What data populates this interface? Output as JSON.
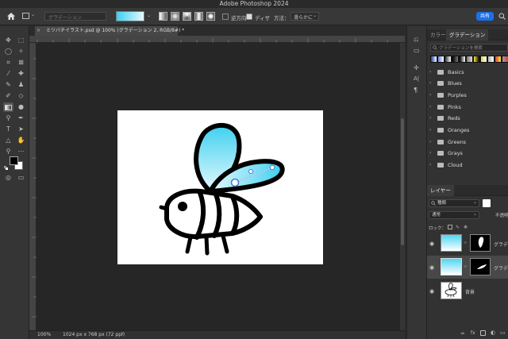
{
  "app": {
    "title": "Adobe Photoshop 2024"
  },
  "options_bar": {
    "preset_placeholder": "グラデーション",
    "reverse_label": "逆方向",
    "dither_label": "ディザ",
    "method_label": "方法：",
    "method_value": "滑らかに",
    "share_label": "共有"
  },
  "document": {
    "tab_title": "ミツバチイラスト.psd @ 100% (グラデーション 2, RGB/8#) *"
  },
  "status_bar": {
    "zoom": "100%",
    "doc_size": "1024 px x 768 px (72 ppi)"
  },
  "gradient_panel": {
    "tabs": [
      "カラー",
      "グラデーション"
    ],
    "search_placeholder": "グラデーションを検索",
    "folders": [
      "Basics",
      "Blues",
      "Purples",
      "Pinks",
      "Reds",
      "Oranges",
      "Greens",
      "Grays",
      "Cloud"
    ],
    "swatch_colors": [
      "#1f3fa8",
      "#ffffff",
      "#6b7fd8",
      "#3a3a3a",
      "#000000",
      "#777777",
      "#ffe640",
      "#d8d84a",
      "#b0b0b0",
      "#e23b3b",
      "#a0a0a0"
    ]
  },
  "layers_panel": {
    "tab": "レイヤー",
    "filter_label": "種類",
    "blend_mode": "通常",
    "opacity_label": "不透明",
    "lock_label": "ロック：",
    "layers": [
      {
        "name": "グラデー"
      },
      {
        "name": "グラデー"
      },
      {
        "name": "背景"
      }
    ]
  },
  "colors": {
    "bee_wing_top": "#3ed0f0",
    "bee_wing_bottom": "#e6f9fd",
    "accent_share": "#1d6fe8"
  }
}
